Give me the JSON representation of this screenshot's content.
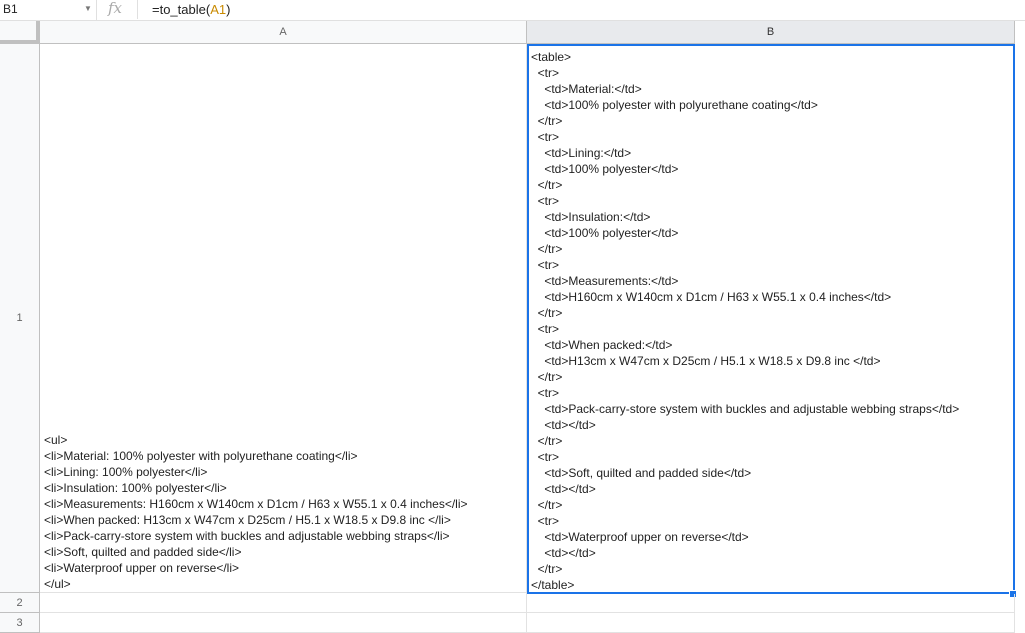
{
  "formula_bar": {
    "name_box": "B1",
    "fx_label": "fx",
    "formula_prefix": "=to_table(",
    "formula_ref": "A1",
    "formula_suffix": ")"
  },
  "columns": [
    "A",
    "B"
  ],
  "rows": [
    "1",
    "2",
    "3"
  ],
  "cells": {
    "A1": "<ul>\n<li>Material: 100% polyester with polyurethane coating</li>\n<li>Lining: 100% polyester</li>\n<li>Insulation: 100% polyester</li>\n<li>Measurements: H160cm x W140cm x D1cm / H63 x W55.1 x 0.4 inches</li>\n<li>When packed: H13cm x W47cm x D25cm / H5.1 x W18.5 x D9.8 inc </li>\n<li>Pack-carry-store system with buckles and adjustable webbing straps</li>\n<li>Soft, quilted and padded side</li>\n<li>Waterproof upper on reverse</li>\n</ul>",
    "B1": "<table>\n  <tr>\n    <td>Material:</td>\n    <td>100% polyester with polyurethane coating</td>\n  </tr>\n  <tr>\n    <td>Lining:</td>\n    <td>100% polyester</td>\n  </tr>\n  <tr>\n    <td>Insulation:</td>\n    <td>100% polyester</td>\n  </tr>\n  <tr>\n    <td>Measurements:</td>\n    <td>H160cm x W140cm x D1cm / H63 x W55.1 x 0.4 inches</td>\n  </tr>\n  <tr>\n    <td>When packed:</td>\n    <td>H13cm x W47cm x D25cm / H5.1 x W18.5 x D9.8 inc </td>\n  </tr>\n  <tr>\n    <td>Pack-carry-store system with buckles and adjustable webbing straps</td>\n    <td></td>\n  </tr>\n  <tr>\n    <td>Soft, quilted and padded side</td>\n    <td></td>\n  </tr>\n  <tr>\n    <td>Waterproof upper on reverse</td>\n    <td></td>\n  </tr>\n</table>"
  },
  "selected_cell": "B1",
  "colors": {
    "selection": "#1a73e8",
    "cell_ref": "#c98a00"
  }
}
